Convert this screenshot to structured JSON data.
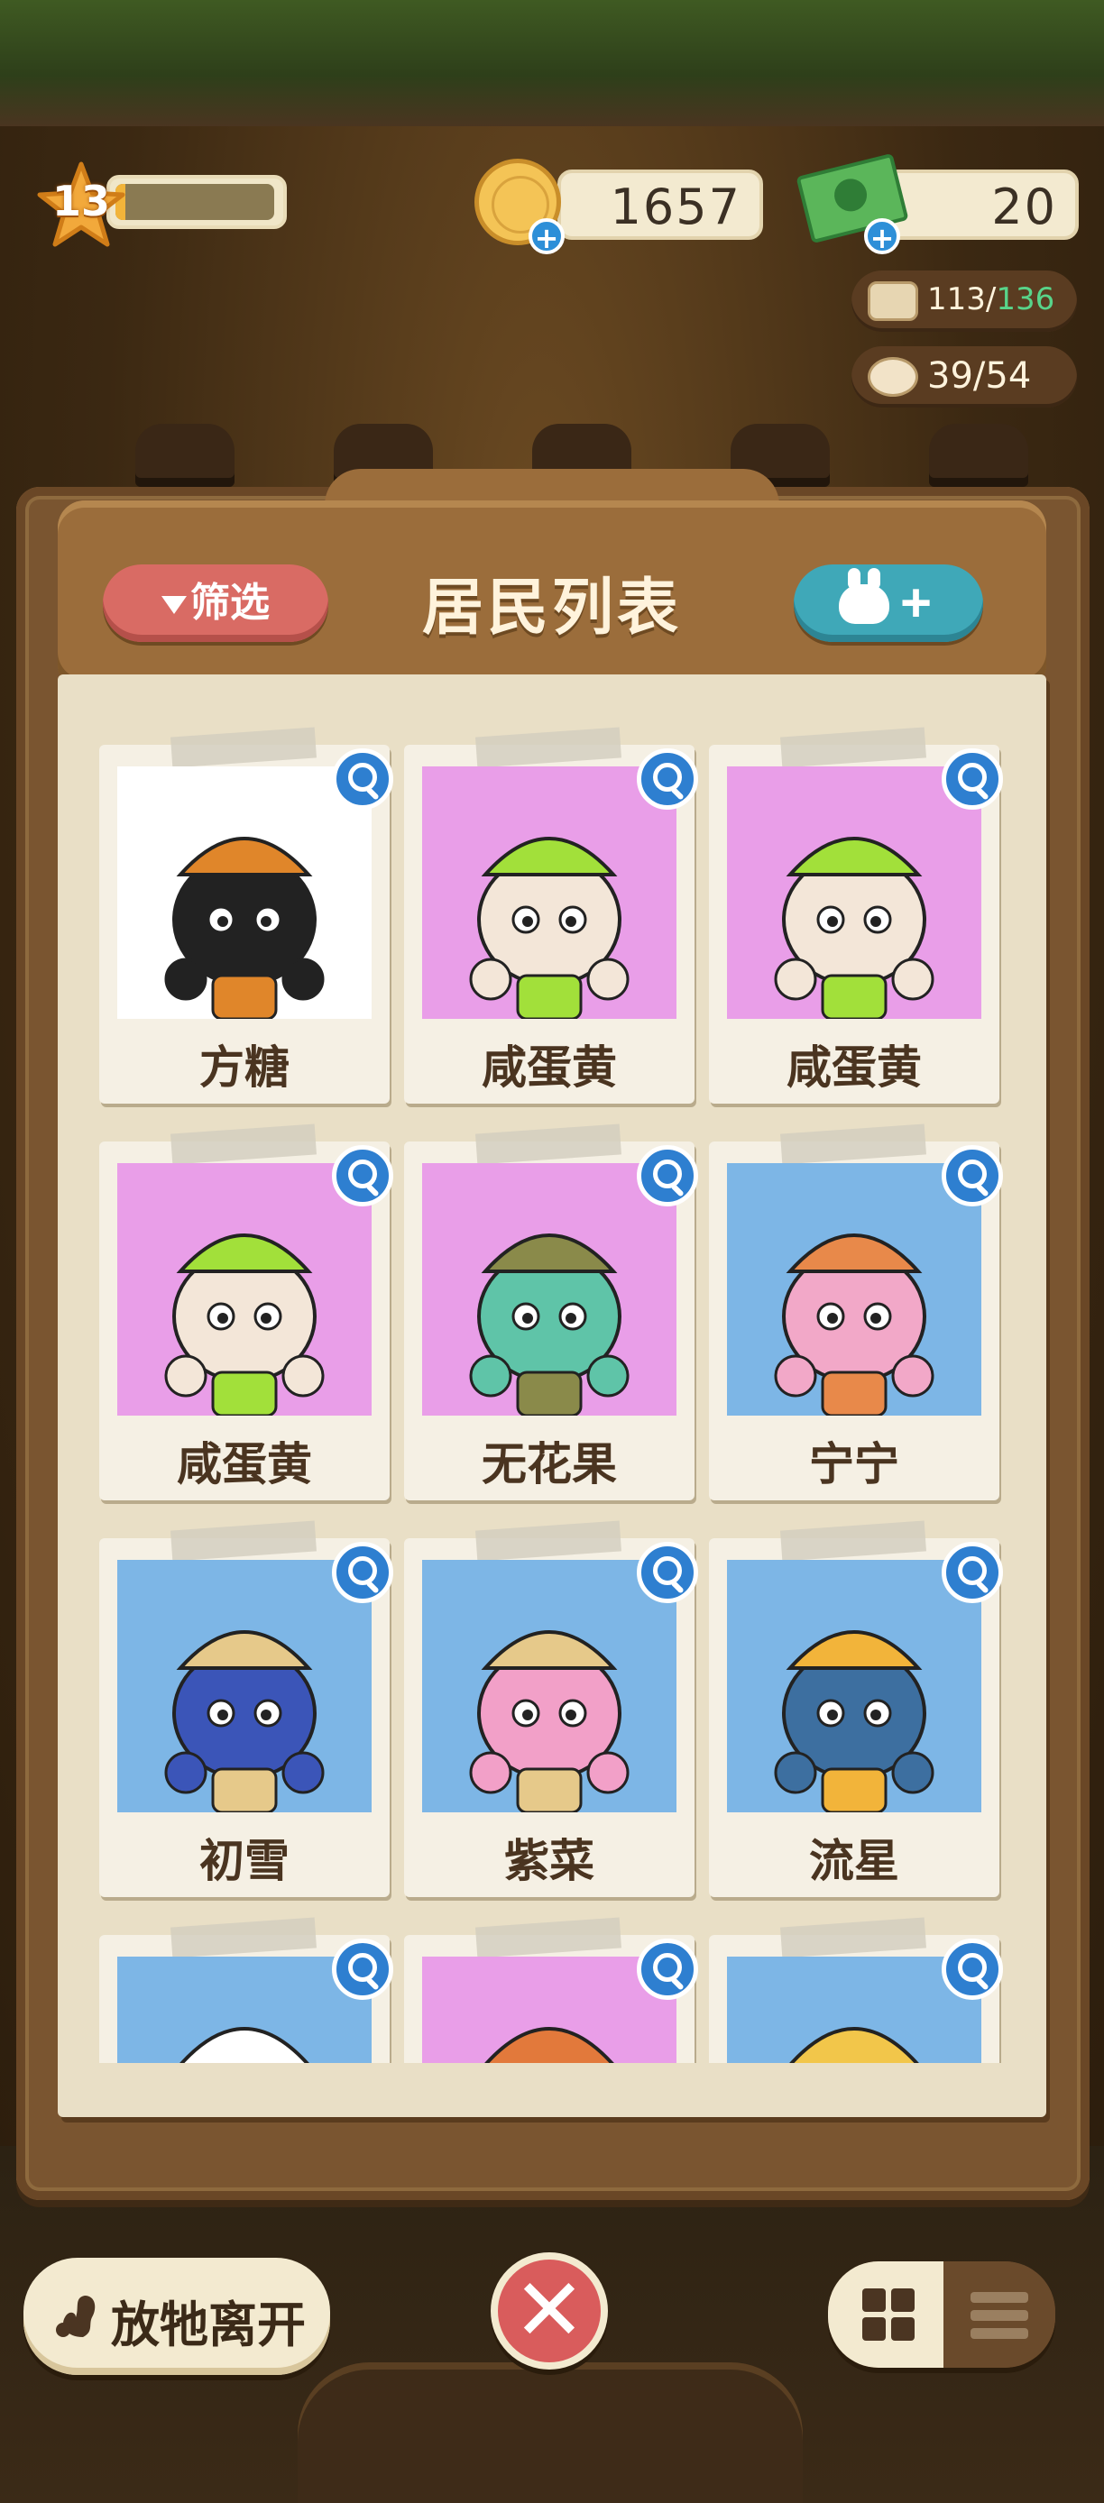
{
  "hud": {
    "level": "13",
    "level_progress": 0.06,
    "coins": "1657",
    "cash": "20",
    "storage_used": "113/",
    "storage_capacity": "136",
    "residents_count": "39/54"
  },
  "panel": {
    "title": "居民列表",
    "filter_label": "筛选",
    "add_label": "+"
  },
  "residents": [
    {
      "name": "方糖",
      "bg": "white"
    },
    {
      "name": "咸蛋黄",
      "bg": "pink"
    },
    {
      "name": "咸蛋黄",
      "bg": "pink"
    },
    {
      "name": "咸蛋黄",
      "bg": "pink"
    },
    {
      "name": "无花果",
      "bg": "pink"
    },
    {
      "name": "宁宁",
      "bg": "blue"
    },
    {
      "name": "初雪",
      "bg": "blue"
    },
    {
      "name": "紫菜",
      "bg": "blue"
    },
    {
      "name": "流星",
      "bg": "blue"
    },
    {
      "name": "",
      "bg": "blue"
    },
    {
      "name": "",
      "bg": "pink"
    },
    {
      "name": "",
      "bg": "blue"
    }
  ],
  "bottom": {
    "release_label": "放牠离开",
    "close_label": "✕"
  },
  "colors": {
    "pink_card": "#e99ee8",
    "blue_card": "#7db6e6",
    "wood": "#9b6d3b",
    "accent_green": "#58d48a"
  },
  "icons": [
    "star-icon",
    "coin-icon",
    "cash-icon",
    "plus-icon",
    "chest-icon",
    "bunny-icon",
    "filter-icon",
    "magnifier-icon",
    "squirrel-icon",
    "close-icon",
    "grid-icon",
    "list-icon"
  ]
}
